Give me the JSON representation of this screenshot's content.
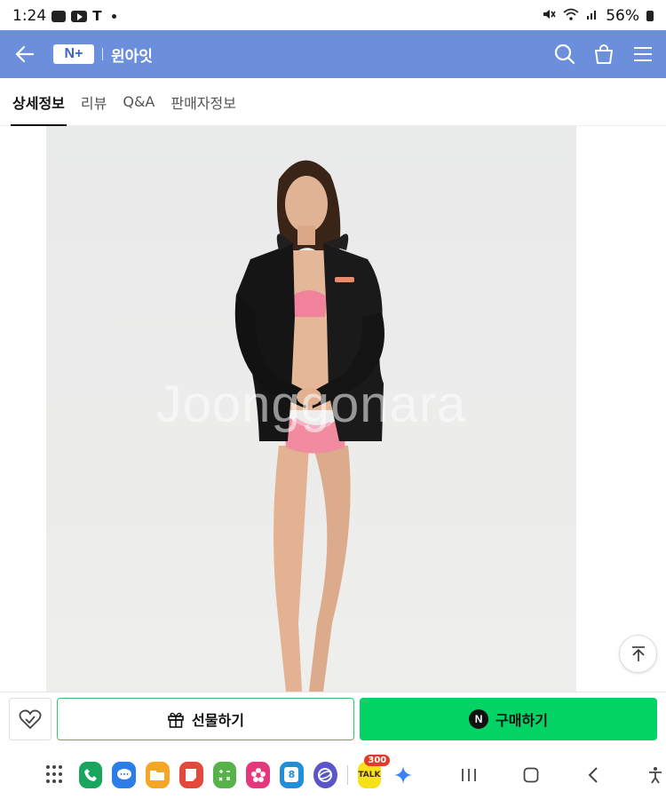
{
  "status_bar": {
    "time": "1:24",
    "battery": "56%"
  },
  "header": {
    "logo_text": "N+",
    "store_name": "윈아잇",
    "bg_color": "#6c8fdc"
  },
  "tabs": [
    {
      "label": "상세정보",
      "active": true
    },
    {
      "label": "리뷰",
      "active": false
    },
    {
      "label": "Q&A",
      "active": false
    },
    {
      "label": "판매자정보",
      "active": false
    }
  ],
  "product_image": {
    "watermark": "Joonggonara",
    "jacket_logo": "BARREL"
  },
  "actions": {
    "gift_label": "선물하기",
    "buy_label": "구매하기",
    "npay_badge": "N",
    "buy_color": "#03d265",
    "gift_border_color": "#36c56b"
  },
  "taskbar": {
    "apps": [
      {
        "name": "phone",
        "color": "#18a55d"
      },
      {
        "name": "messages",
        "color": "#2b7de9"
      },
      {
        "name": "my-files",
        "color": "#f5a623"
      },
      {
        "name": "notes",
        "color": "#e4473c"
      },
      {
        "name": "calculator",
        "color": "#57b249"
      },
      {
        "name": "gallery",
        "color": "#e6377c"
      },
      {
        "name": "calendar",
        "color": "#1e8fd8"
      },
      {
        "name": "internet",
        "color": "#5a55c9"
      },
      {
        "name": "kakaotalk",
        "color": "#f7e11a"
      }
    ],
    "calendar_day": "8",
    "kakaotalk_label": "TALK",
    "kakaotalk_badge": "300"
  }
}
